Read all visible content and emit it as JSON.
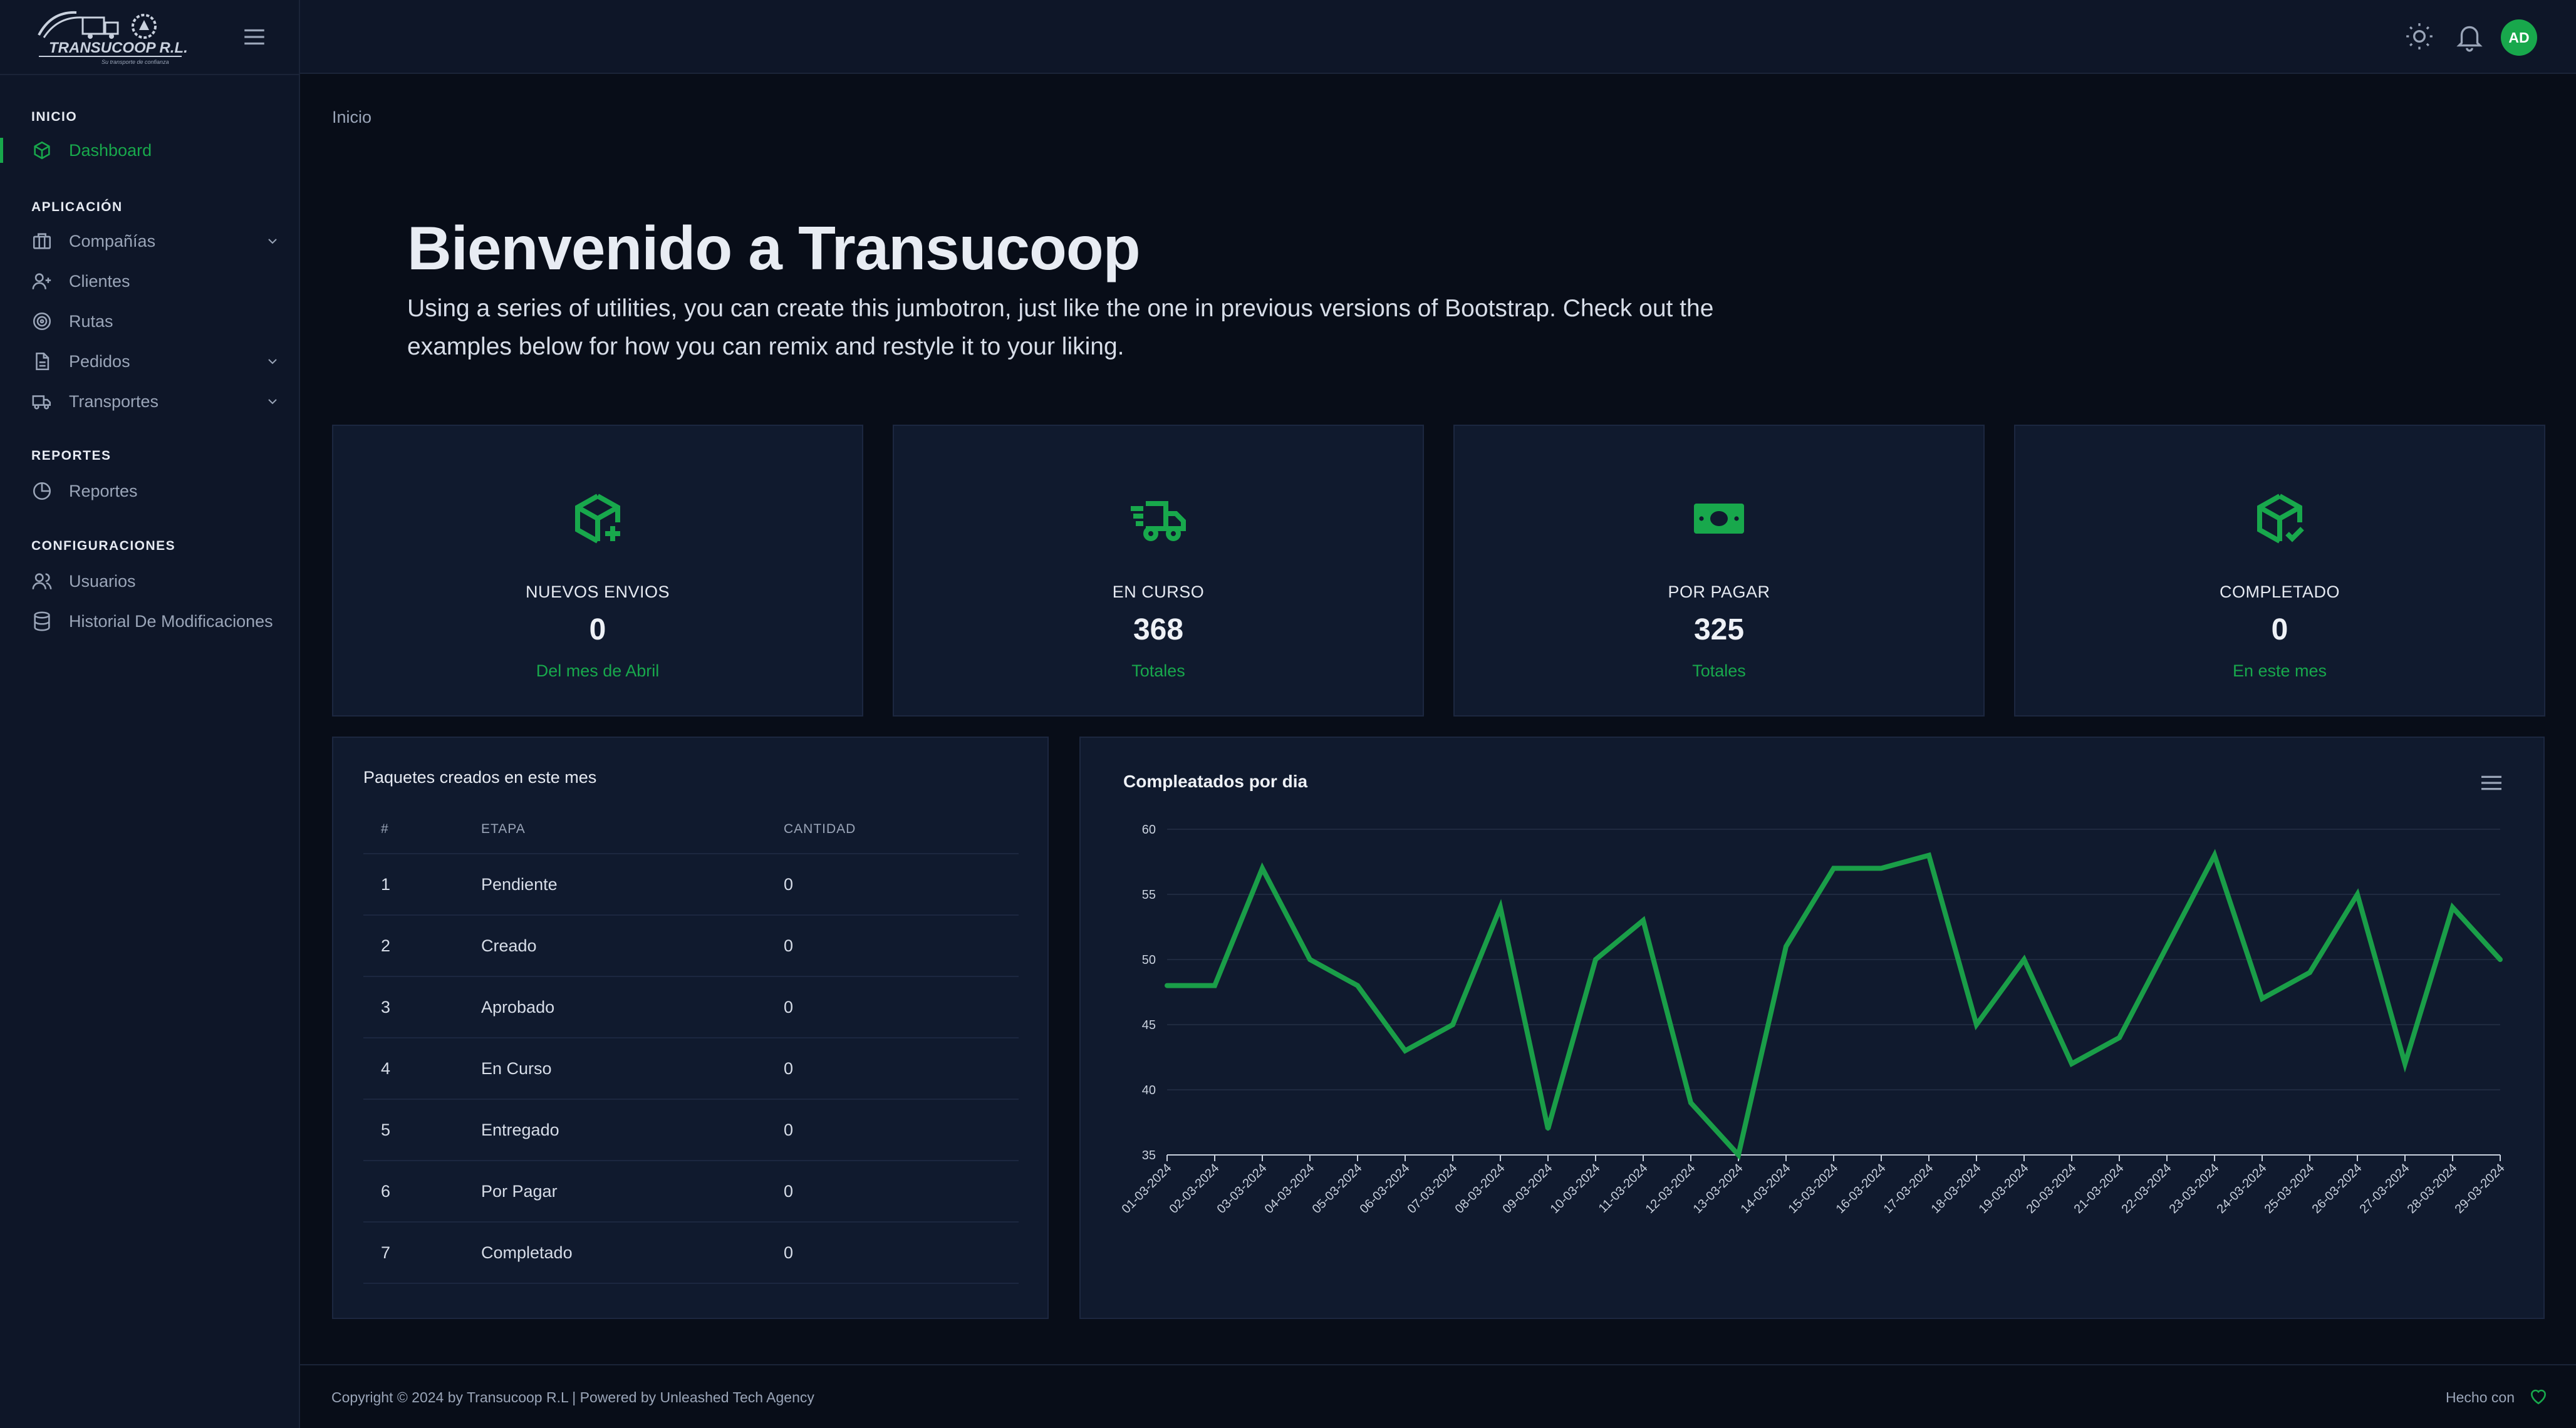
{
  "brand": {
    "logo_text": "TRANSUCOOP R.L.",
    "logo_tagline": "Su transporte de confianza"
  },
  "sidebar": {
    "sections": [
      {
        "title": "INICIO"
      },
      {
        "title": "APLICACIÓN"
      },
      {
        "title": "REPORTES"
      },
      {
        "title": "CONFIGURACIONES"
      }
    ],
    "items": [
      {
        "label": "Dashboard",
        "icon": "cube-icon",
        "active": true
      },
      {
        "label": "Compañías",
        "icon": "briefcase-icon",
        "expandable": true
      },
      {
        "label": "Clientes",
        "icon": "user-plus-icon"
      },
      {
        "label": "Rutas",
        "icon": "target-icon"
      },
      {
        "label": "Pedidos",
        "icon": "file-icon",
        "expandable": true
      },
      {
        "label": "Transportes",
        "icon": "truck-icon",
        "expandable": true
      },
      {
        "label": "Reportes",
        "icon": "pie-chart-icon"
      },
      {
        "label": "Usuarios",
        "icon": "users-icon"
      },
      {
        "label": "Historial De Modificaciones",
        "icon": "database-icon"
      }
    ]
  },
  "topbar": {
    "icons": [
      "sun-icon",
      "bell-icon"
    ],
    "avatar_initials": "AD"
  },
  "breadcrumb": "Inicio",
  "hero": {
    "title": "Bienvenido a Transucoop",
    "text": "Using a series of utilities, you can create this jumbotron, just like the one in previous versions of Bootstrap. Check out the examples below for how you can remix and restyle it to your liking."
  },
  "stats": [
    {
      "label": "NUEVOS ENVIOS",
      "value": "0",
      "sub": "Del mes de Abril",
      "icon": "package-plus-icon"
    },
    {
      "label": "EN CURSO",
      "value": "368",
      "sub": "Totales",
      "icon": "truck-fast-icon"
    },
    {
      "label": "POR PAGAR",
      "value": "325",
      "sub": "Totales",
      "icon": "cash-icon"
    },
    {
      "label": "COMPLETADO",
      "value": "0",
      "sub": "En este mes",
      "icon": "package-check-icon"
    }
  ],
  "packages_table": {
    "title": "Paquetes creados en este mes",
    "headers": [
      "#",
      "ETAPA",
      "CANTIDAD"
    ],
    "rows": [
      [
        "1",
        "Pendiente",
        "0"
      ],
      [
        "2",
        "Creado",
        "0"
      ],
      [
        "3",
        "Aprobado",
        "0"
      ],
      [
        "4",
        "En Curso",
        "0"
      ],
      [
        "5",
        "Entregado",
        "0"
      ],
      [
        "6",
        "Por Pagar",
        "0"
      ],
      [
        "7",
        "Completado",
        "0"
      ]
    ]
  },
  "chart_data": {
    "type": "line",
    "title": "Compleatados por dia",
    "xlabel": "",
    "ylabel": "",
    "ylim": [
      35,
      60
    ],
    "yticks": [
      35,
      40,
      45,
      50,
      55,
      60
    ],
    "grid": true,
    "color": "#1a9e48",
    "x": [
      "01-03-2024",
      "02-03-2024",
      "03-03-2024",
      "04-03-2024",
      "05-03-2024",
      "06-03-2024",
      "07-03-2024",
      "08-03-2024",
      "09-03-2024",
      "10-03-2024",
      "11-03-2024",
      "12-03-2024",
      "13-03-2024",
      "14-03-2024",
      "15-03-2024",
      "16-03-2024",
      "17-03-2024",
      "18-03-2024",
      "19-03-2024",
      "20-03-2024",
      "21-03-2024",
      "22-03-2024",
      "23-03-2024",
      "24-03-2024",
      "25-03-2024",
      "26-03-2024",
      "27-03-2024",
      "28-03-2024",
      "29-03-2024"
    ],
    "series": [
      {
        "values": [
          48,
          48,
          57,
          50,
          48,
          43,
          45,
          54,
          37,
          50,
          53,
          39,
          35,
          51,
          57,
          57,
          58,
          45,
          50,
          42,
          44,
          51,
          58,
          47,
          49,
          55,
          42,
          54,
          50
        ]
      }
    ]
  },
  "footer": {
    "copyright": "Copyright © 2024 by Transucoop R.L | Powered by Unleashed Tech Agency",
    "made_with": "Hecho con"
  },
  "colors": {
    "accent": "#18a84c",
    "background": "#080d18",
    "panel": "#101a2e"
  }
}
